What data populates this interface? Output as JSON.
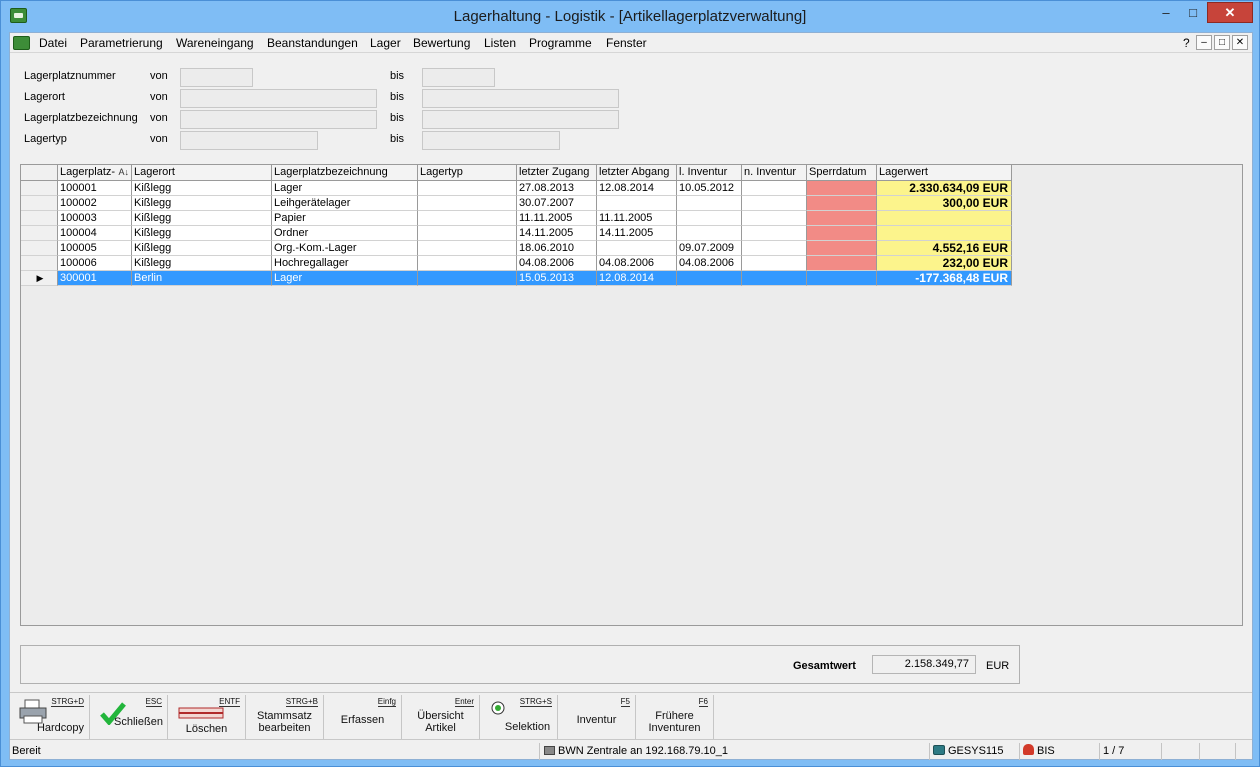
{
  "window": {
    "title": "Lagerhaltung - Logistik - [Artikellagerplatzverwaltung]",
    "min_glyph": "–",
    "max_glyph": "□",
    "close_glyph": "✕"
  },
  "menu": {
    "items": [
      "Datei",
      "Parametrierung",
      "Wareneingang",
      "Beanstandungen",
      "Lager",
      "Bewertung",
      "Listen",
      "Programme",
      "Fenster"
    ],
    "help": "?"
  },
  "filter": {
    "rows": [
      {
        "label": "Lagerplatznummer",
        "from": "von",
        "to": "bis"
      },
      {
        "label": "Lagerort",
        "from": "von",
        "to": "bis"
      },
      {
        "label": "Lagerplatzbezeichnung",
        "from": "von",
        "to": "bis"
      },
      {
        "label": "Lagertyp",
        "from": "von",
        "to": "bis"
      }
    ]
  },
  "grid": {
    "columns": [
      "Lagerplatz-",
      "Lagerort",
      "Lagerplatzbezeichnung",
      "Lagertyp",
      "letzter Zugang",
      "letzter Abgang",
      "l. Inventur",
      "n. Inventur",
      "Sperrdatum",
      "Lagerwert"
    ],
    "sort_indicator": "A↓",
    "selected_marker": "▶",
    "rows": [
      [
        "100001",
        "Kißlegg",
        "Lager",
        "",
        "27.08.2013",
        "12.08.2014",
        "10.05.2012",
        "",
        "",
        "2.330.634,09 EUR"
      ],
      [
        "100002",
        "Kißlegg",
        "Leihgerätelager",
        "",
        "30.07.2007",
        "",
        "",
        "",
        "",
        "300,00 EUR"
      ],
      [
        "100003",
        "Kißlegg",
        "Papier",
        "",
        "11.11.2005",
        "11.11.2005",
        "",
        "",
        "",
        ""
      ],
      [
        "100004",
        "Kißlegg",
        "Ordner",
        "",
        "14.11.2005",
        "14.11.2005",
        "",
        "",
        "",
        ""
      ],
      [
        "100005",
        "Kißlegg",
        "Org.-Kom.-Lager",
        "",
        "18.06.2010",
        "",
        "09.07.2009",
        "",
        "",
        "4.552,16 EUR"
      ],
      [
        "100006",
        "Kißlegg",
        "Hochregallager",
        "",
        "04.08.2006",
        "04.08.2006",
        "04.08.2006",
        "",
        "",
        "232,00 EUR"
      ],
      [
        "300001",
        "Berlin",
        "Lager",
        "",
        "15.05.2013",
        "12.08.2014",
        "",
        "",
        "",
        "-177.368,48 EUR"
      ]
    ]
  },
  "total": {
    "label": "Gesamtwert",
    "value": "2.158.349,77",
    "unit": "EUR"
  },
  "toolbar": [
    {
      "key": "STRG+D",
      "label1": "Hardcopy",
      "label2": ""
    },
    {
      "key": "ESC",
      "label1": "Schließen",
      "label2": ""
    },
    {
      "key": "ENTF",
      "label1": "Löschen",
      "label2": ""
    },
    {
      "key": "STRG+B",
      "label1": "Stammsatz",
      "label2": "bearbeiten"
    },
    {
      "key": "Einfg",
      "label1": "Erfassen",
      "label2": ""
    },
    {
      "key": "Enter",
      "label1": "Übersicht",
      "label2": "Artikel"
    },
    {
      "key": "STRG+S",
      "label1": "Selektion",
      "label2": ""
    },
    {
      "key": "F5",
      "label1": "Inventur",
      "label2": ""
    },
    {
      "key": "F6",
      "label1": "Frühere",
      "label2": "Inventuren"
    }
  ],
  "status": {
    "state": "Bereit",
    "connection": "BWN Zentrale an 192.168.79.10_1",
    "system": "GESYS115",
    "user": "BIS",
    "record": "1 / 7"
  },
  "colors": {
    "title_bg": "#7fbdf5",
    "selection": "#3399ff",
    "sperr": "#f28b86",
    "wert": "#fcf48c"
  }
}
